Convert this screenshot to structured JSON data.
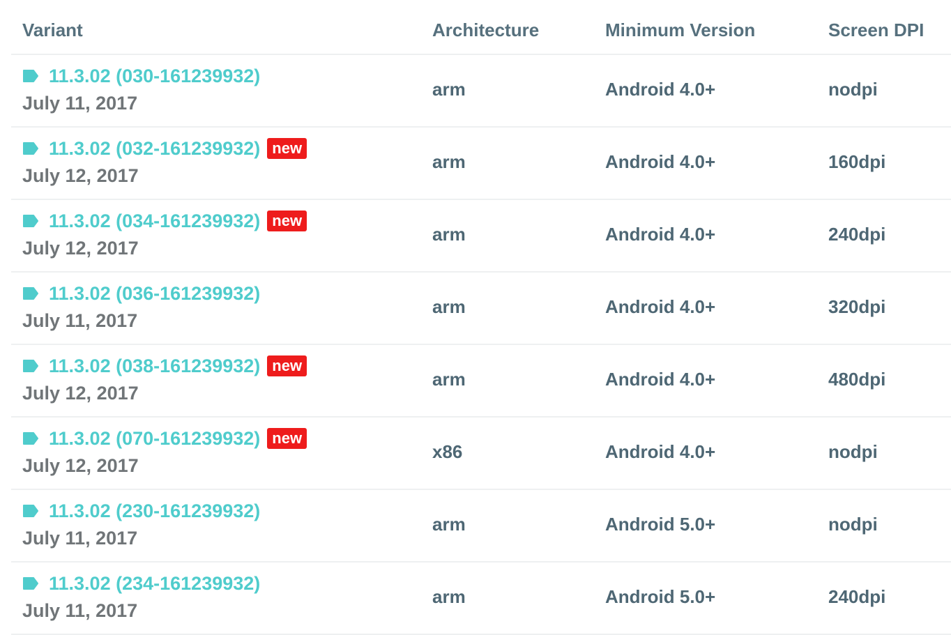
{
  "columns": {
    "variant": "Variant",
    "architecture": "Architecture",
    "minimum_version": "Minimum Version",
    "screen_dpi": "Screen DPI"
  },
  "badge_label": "new",
  "colors": {
    "link": "#4fcccc",
    "badge": "#ee1c1c",
    "header_text": "#56707d",
    "cell_text": "#4e6774",
    "date_text": "#707578"
  },
  "icons": {
    "variant_icon": "tag-icon"
  },
  "rows": [
    {
      "variant": "11.3.02 (030-161239932)",
      "is_new": false,
      "date": "July 11, 2017",
      "architecture": "arm",
      "min_version": "Android 4.0+",
      "dpi": "nodpi"
    },
    {
      "variant": "11.3.02 (032-161239932)",
      "is_new": true,
      "date": "July 12, 2017",
      "architecture": "arm",
      "min_version": "Android 4.0+",
      "dpi": "160dpi"
    },
    {
      "variant": "11.3.02 (034-161239932)",
      "is_new": true,
      "date": "July 12, 2017",
      "architecture": "arm",
      "min_version": "Android 4.0+",
      "dpi": "240dpi"
    },
    {
      "variant": "11.3.02 (036-161239932)",
      "is_new": false,
      "date": "July 11, 2017",
      "architecture": "arm",
      "min_version": "Android 4.0+",
      "dpi": "320dpi"
    },
    {
      "variant": "11.3.02 (038-161239932)",
      "is_new": true,
      "date": "July 12, 2017",
      "architecture": "arm",
      "min_version": "Android 4.0+",
      "dpi": "480dpi"
    },
    {
      "variant": "11.3.02 (070-161239932)",
      "is_new": true,
      "date": "July 12, 2017",
      "architecture": "x86",
      "min_version": "Android 4.0+",
      "dpi": "nodpi"
    },
    {
      "variant": "11.3.02 (230-161239932)",
      "is_new": false,
      "date": "July 11, 2017",
      "architecture": "arm",
      "min_version": "Android 5.0+",
      "dpi": "nodpi"
    },
    {
      "variant": "11.3.02 (234-161239932)",
      "is_new": false,
      "date": "July 11, 2017",
      "architecture": "arm",
      "min_version": "Android 5.0+",
      "dpi": "240dpi"
    }
  ]
}
